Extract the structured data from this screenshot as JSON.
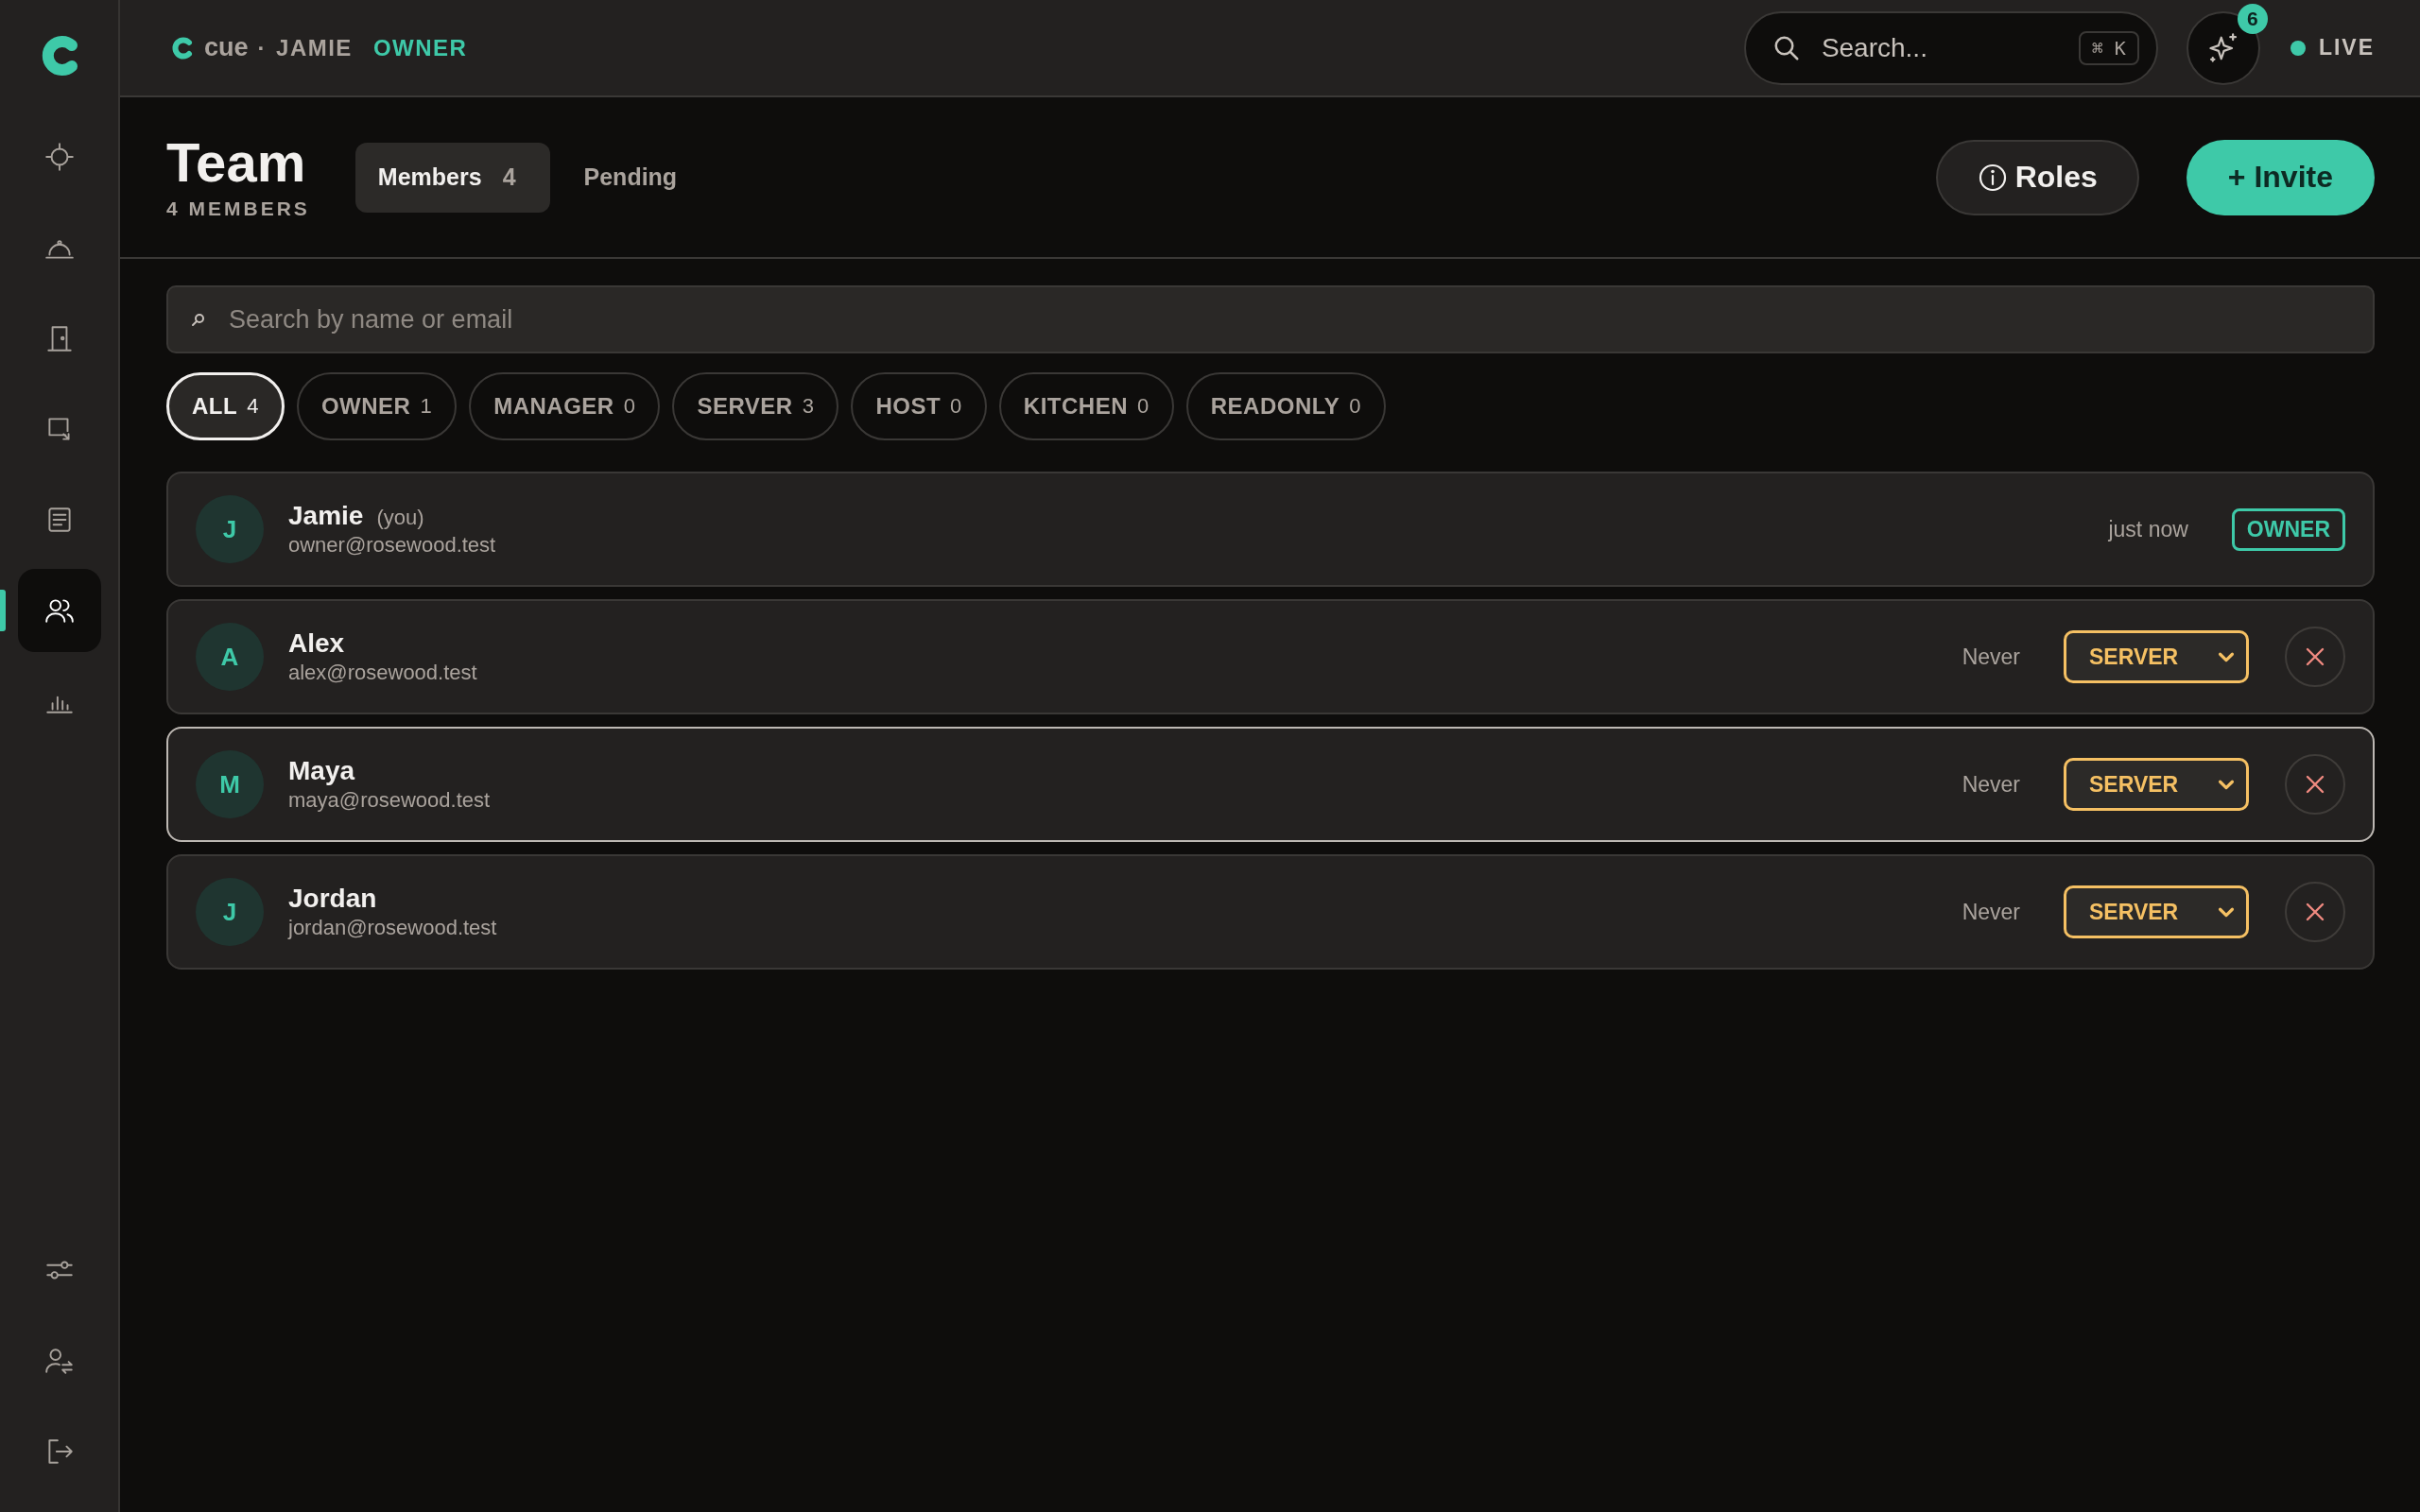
{
  "sidebar": {
    "nav": [
      {
        "kind": "crosshair",
        "selected": false
      },
      {
        "kind": "cloche",
        "selected": false
      },
      {
        "kind": "door",
        "selected": false
      },
      {
        "kind": "screen",
        "selected": false
      },
      {
        "kind": "document",
        "selected": false
      },
      {
        "kind": "people",
        "selected": true
      },
      {
        "kind": "chart",
        "selected": false
      }
    ],
    "bottom": [
      {
        "kind": "sliders"
      },
      {
        "kind": "user-switch"
      },
      {
        "kind": "logout"
      }
    ]
  },
  "topbar": {
    "brand": "cue",
    "separator": "·",
    "user": "JAMIE",
    "role": "OWNER",
    "search": {
      "placeholder": "Search...",
      "shortcut": "⌘ K"
    },
    "notifications": "6",
    "status": "LIVE"
  },
  "header": {
    "title": "Team",
    "subtitle": "4 MEMBERS",
    "tabs": [
      {
        "label": "Members",
        "count": "4",
        "selected": true
      },
      {
        "label": "Pending",
        "selected": false
      }
    ],
    "roles_button": "Roles",
    "invite_button": "+ Invite"
  },
  "member_search": {
    "placeholder": "Search by name or email"
  },
  "filters": [
    {
      "label": "ALL",
      "count": "4",
      "selected": true
    },
    {
      "label": "OWNER",
      "count": "1",
      "selected": false
    },
    {
      "label": "MANAGER",
      "count": "0",
      "selected": false
    },
    {
      "label": "SERVER",
      "count": "3",
      "selected": false
    },
    {
      "label": "HOST",
      "count": "0",
      "selected": false
    },
    {
      "label": "KITCHEN",
      "count": "0",
      "selected": false
    },
    {
      "label": "READONLY",
      "count": "0",
      "selected": false
    }
  ],
  "members": [
    {
      "initial": "J",
      "name": "Jamie",
      "tag": "(you)",
      "email": "owner@rosewood.test",
      "last_seen": "just now",
      "role": "OWNER",
      "kind": "badge",
      "selected": false
    },
    {
      "initial": "A",
      "name": "Alex",
      "email": "alex@rosewood.test",
      "last_seen": "Never",
      "role": "SERVER",
      "kind": "select",
      "selected": false
    },
    {
      "initial": "M",
      "name": "Maya",
      "email": "maya@rosewood.test",
      "last_seen": "Never",
      "role": "SERVER",
      "kind": "select",
      "selected": true
    },
    {
      "initial": "J",
      "name": "Jordan",
      "email": "jordan@rosewood.test",
      "last_seen": "Never",
      "role": "SERVER",
      "kind": "select",
      "selected": false
    }
  ]
}
